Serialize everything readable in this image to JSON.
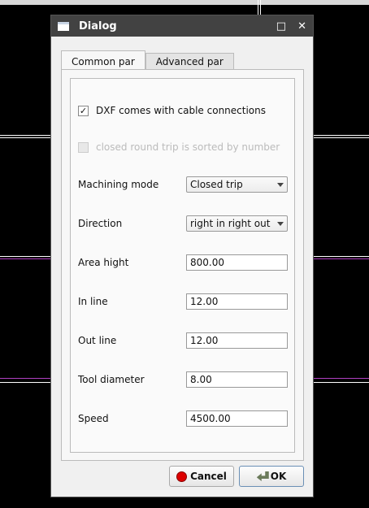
{
  "window": {
    "title": "Dialog",
    "icons": [
      "window-icon",
      "maximize-icon",
      "close-icon"
    ]
  },
  "tabs": [
    {
      "label": "Common par",
      "active": true
    },
    {
      "label": "Advanced par",
      "active": false
    }
  ],
  "checkboxes": [
    {
      "label": "DXF comes with cable connections",
      "checked": true,
      "enabled": true
    },
    {
      "label": "closed round trip is sorted by number",
      "checked": false,
      "enabled": false
    }
  ],
  "fields": {
    "machining_mode": {
      "label": "Machining mode",
      "value": "Closed  trip"
    },
    "direction": {
      "label": "Direction",
      "value": "right in right out"
    },
    "area_hight": {
      "label": "Area hight",
      "value": "800.00"
    },
    "in_line": {
      "label": "In line",
      "value": "12.00"
    },
    "out_line": {
      "label": "Out line",
      "value": "12.00"
    },
    "tool_diameter": {
      "label": "Tool diameter",
      "value": "8.00"
    },
    "speed": {
      "label": "Speed",
      "value": "4500.00"
    }
  },
  "buttons": {
    "cancel": "Cancel",
    "ok": "OK"
  },
  "colors": {
    "titlebar": "#424242",
    "background": "#000000",
    "magenta_line": "#b040c0"
  }
}
